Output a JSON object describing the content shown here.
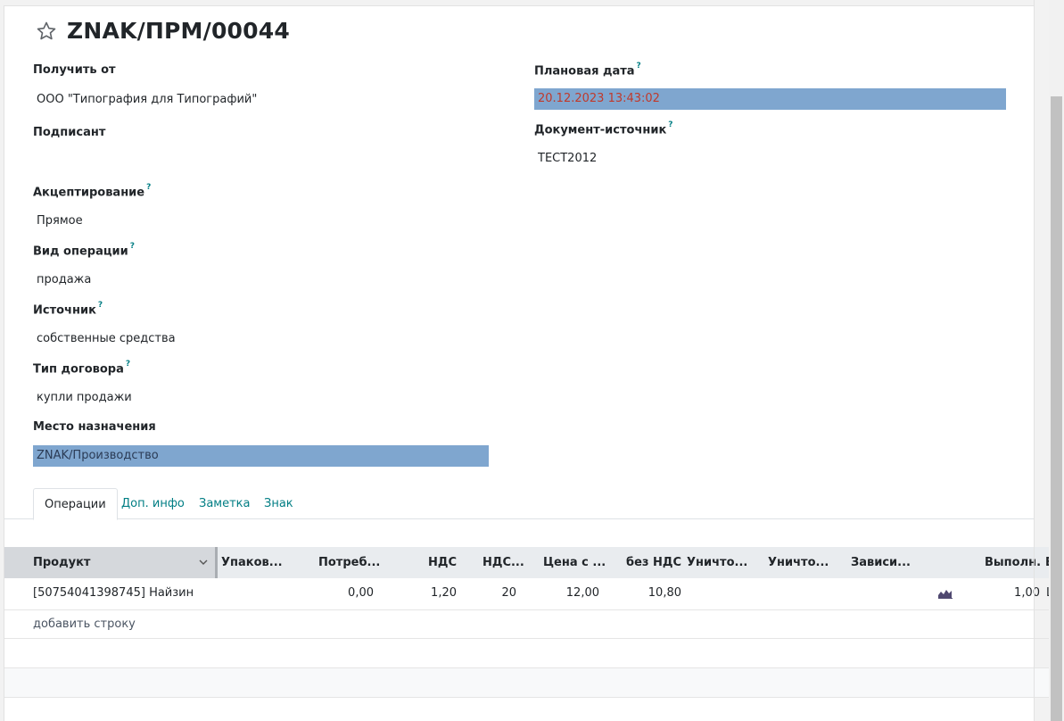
{
  "record": {
    "title": "ZNAK/ПРМ/00044"
  },
  "fields": {
    "receive_from": {
      "label": "Получить от",
      "value": "ООО \"Типография для Типографий\""
    },
    "signer": {
      "label": "Подписант",
      "value": ""
    },
    "acceptance": {
      "label": "Акцептирование",
      "value": "Прямое"
    },
    "operation_type": {
      "label": "Вид операции",
      "value": "продажа"
    },
    "source": {
      "label": "Источник",
      "value": "собственные средства"
    },
    "contract_type": {
      "label": "Тип договора",
      "value": "купли продажи"
    },
    "destination": {
      "label": "Место назначения",
      "value": "ZNAK/Производство"
    },
    "planned_date": {
      "label": "Плановая дата",
      "value": "20.12.2023 13:43:02"
    },
    "source_document": {
      "label": "Документ-источник",
      "value": "ТЕСТ2012"
    },
    "help_mark": "?"
  },
  "tabs": [
    {
      "label": "Операции",
      "active": true
    },
    {
      "label": "Доп. инфо"
    },
    {
      "label": "Заметка"
    },
    {
      "label": "Знак"
    }
  ],
  "table": {
    "columns": [
      "Продукт",
      "Упаков...",
      "Потреб...",
      "НДС",
      "НДС...",
      "Цена с ...",
      "без НДС",
      "Уничто...",
      "Уничто...",
      "Зависи...",
      "Выполн...",
      "Е"
    ],
    "rows": [
      {
        "product": "[50754041398745] Найзин",
        "consumed": "0,00",
        "vat": "1,20",
        "vat_rate": "20",
        "price_with_vat": "12,00",
        "price_without_vat": "10,80",
        "done": "1,00",
        "extra": "L"
      }
    ],
    "add_line": "добавить строку"
  },
  "colors": {
    "highlight": "#7fa6cf",
    "date_text": "#c0392b",
    "link": "#017e84"
  }
}
